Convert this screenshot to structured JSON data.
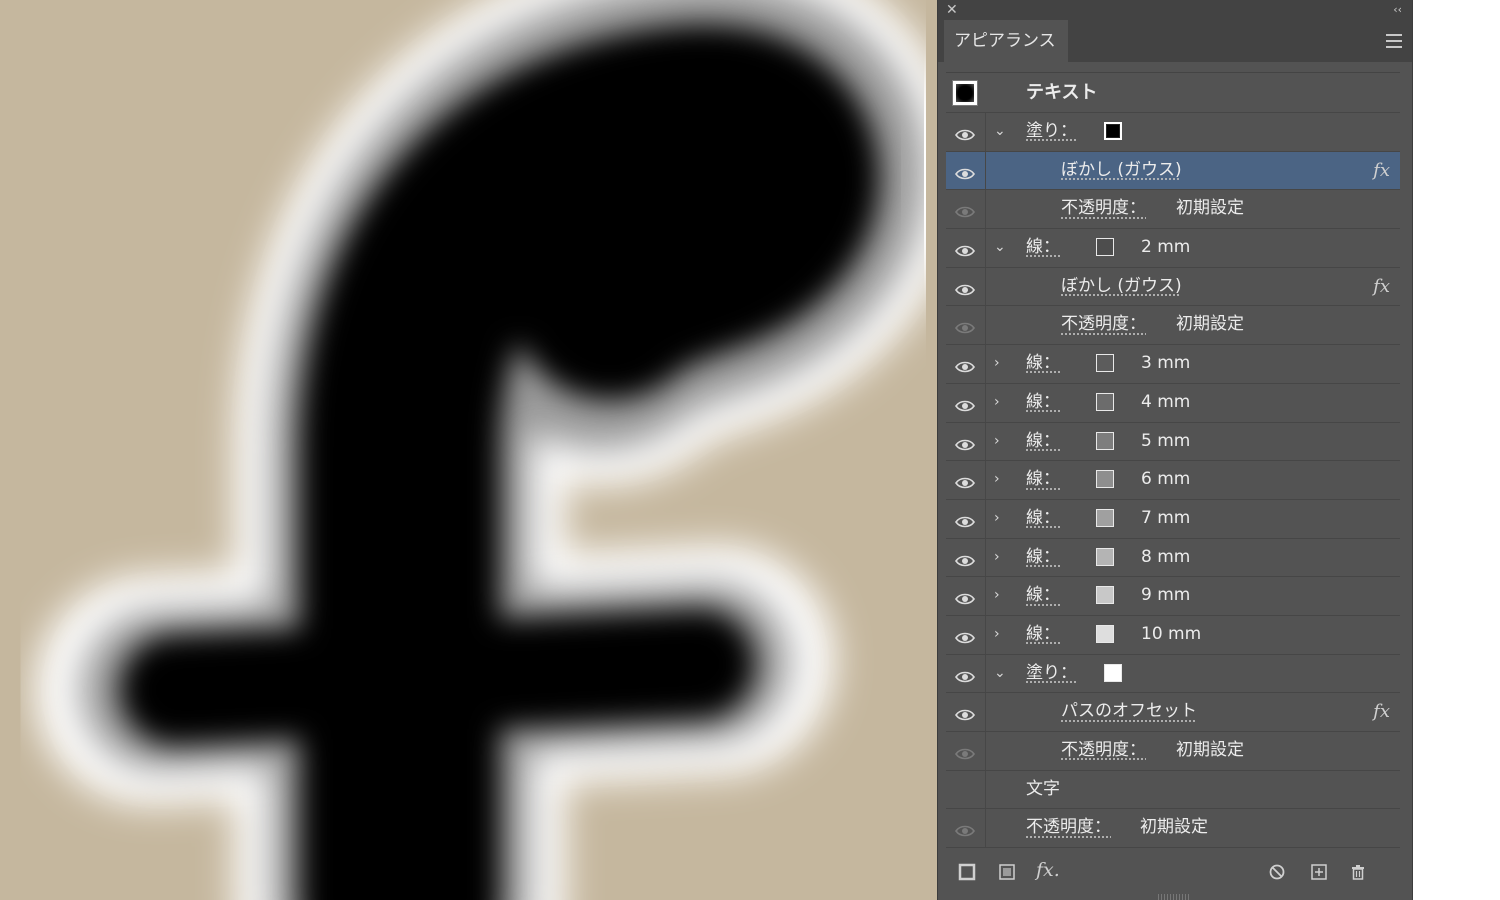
{
  "canvas": {
    "glyph": "f",
    "background": "#c5b79e"
  },
  "panel": {
    "tab": "アピアランス",
    "close_glyph": "✕",
    "collapse_glyph": "‹‹"
  },
  "rows": [
    {
      "kind": "title",
      "label": "テキスト"
    },
    {
      "kind": "fill",
      "eye": true,
      "arrow": "down",
      "label": "塗り：",
      "swatch": "#000000"
    },
    {
      "kind": "effect",
      "eye": true,
      "label": "ぼかし (ガウス)",
      "fx": "fx",
      "selected": true
    },
    {
      "kind": "opacity",
      "eye": true,
      "eye_dim": true,
      "label": "不透明度：",
      "value": "初期設定"
    },
    {
      "kind": "stroke",
      "eye": true,
      "arrow": "down",
      "label": "線：",
      "swatch": "#4d4d4d",
      "value": "2 mm"
    },
    {
      "kind": "effect",
      "eye": true,
      "label": "ぼかし (ガウス)",
      "fx": "fx"
    },
    {
      "kind": "opacity",
      "eye": true,
      "eye_dim": true,
      "label": "不透明度：",
      "value": "初期設定"
    },
    {
      "kind": "stroke",
      "eye": true,
      "arrow": "right",
      "label": "線：",
      "swatch": "#5c5c5c",
      "value": "3 mm"
    },
    {
      "kind": "stroke",
      "eye": true,
      "arrow": "right",
      "label": "線：",
      "swatch": "#6c6c6c",
      "value": "4 mm"
    },
    {
      "kind": "stroke",
      "eye": true,
      "arrow": "right",
      "label": "線：",
      "swatch": "#7d7d7d",
      "value": "5 mm"
    },
    {
      "kind": "stroke",
      "eye": true,
      "arrow": "right",
      "label": "線：",
      "swatch": "#8e8e8e",
      "value": "6 mm"
    },
    {
      "kind": "stroke",
      "eye": true,
      "arrow": "right",
      "label": "線：",
      "swatch": "#a0a0a0",
      "value": "7 mm"
    },
    {
      "kind": "stroke",
      "eye": true,
      "arrow": "right",
      "label": "線：",
      "swatch": "#b4b4b4",
      "value": "8 mm"
    },
    {
      "kind": "stroke",
      "eye": true,
      "arrow": "right",
      "label": "線：",
      "swatch": "#c8c8c8",
      "value": "9 mm"
    },
    {
      "kind": "stroke",
      "eye": true,
      "arrow": "right",
      "label": "線：",
      "swatch": "#dedede",
      "value": "10 mm"
    },
    {
      "kind": "fill",
      "eye": true,
      "arrow": "down",
      "label": "塗り：",
      "swatch": "#ffffff"
    },
    {
      "kind": "effect",
      "eye": true,
      "label": "パスのオフセット",
      "fx": "fx"
    },
    {
      "kind": "opacity",
      "eye": true,
      "eye_dim": true,
      "label": "不透明度：",
      "value": "初期設定"
    },
    {
      "kind": "plain",
      "eye": false,
      "label": "文字"
    },
    {
      "kind": "opacity-top",
      "eye": true,
      "eye_dim": true,
      "label": "不透明度：",
      "value": "初期設定"
    }
  ],
  "bottom_icons": [
    "new-stroke-icon",
    "new-fill-icon",
    "add-effect-icon",
    "clear-appearance-icon",
    "duplicate-item-icon",
    "delete-item-icon"
  ],
  "bottom_fx_label": "fx."
}
